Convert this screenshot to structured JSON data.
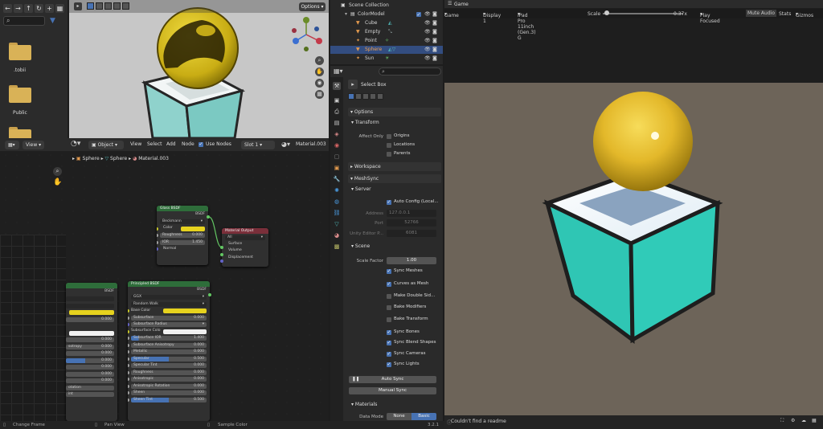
{
  "file_browser": {
    "folders": [
      {
        "label": ".tobii"
      },
      {
        "label": "Public"
      },
      {
        "label": ""
      }
    ]
  },
  "viewport3d": {
    "options_label": "Options"
  },
  "node_editor": {
    "editor_type": "Object",
    "menu": [
      "View",
      "Select",
      "Add",
      "Node"
    ],
    "use_nodes_label": "Use Nodes",
    "use_nodes": true,
    "slot": "Slot 1",
    "material_name": "Material.003",
    "breadcrumb": [
      "Sphere",
      "Sphere",
      "Material.003"
    ],
    "view_label": "View",
    "glass_node": {
      "title": "Glass BSDF",
      "output": "BSDF",
      "distribution": "Beckmann",
      "color_label": "Color",
      "roughness_label": "Roughness",
      "roughness": "0.000",
      "ior_label": "IOR",
      "ior": "1.450",
      "normal_label": "Normal"
    },
    "output_node": {
      "title": "Material Output",
      "target": "All",
      "inputs": [
        "Surface",
        "Volume",
        "Displacement"
      ]
    },
    "principled_node": {
      "title": "Principled BSDF",
      "output": "BSDF",
      "distribution": "GGX",
      "subsurface_method": "Random Walk",
      "rows": [
        {
          "label": "Base Color",
          "value": ""
        },
        {
          "label": "Subsurface",
          "value": "0.000"
        },
        {
          "label": "Subsurface Radius",
          "value": ""
        },
        {
          "label": "Subsurface Colo",
          "value": ""
        },
        {
          "label": "Subsurface IOR",
          "value": "1.400"
        },
        {
          "label": "Subsurface Anisotropy",
          "value": "0.000"
        },
        {
          "label": "Metallic",
          "value": "0.000"
        },
        {
          "label": "Specular",
          "value": "0.500"
        },
        {
          "label": "Specular Tint",
          "value": "0.000"
        },
        {
          "label": "Roughness",
          "value": "0.000"
        },
        {
          "label": "Anisotropic",
          "value": "0.000"
        },
        {
          "label": "Anisotropic Rotation",
          "value": "0.000"
        },
        {
          "label": "Sheen",
          "value": "0.000"
        },
        {
          "label": "Sheen Tint",
          "value": "0.500"
        }
      ]
    },
    "partial_node": {
      "output": "BSDF",
      "values": [
        "0.000",
        "0.000",
        "0.000",
        "0.000",
        "0.000",
        "0.000",
        "0.000",
        "0.000"
      ],
      "labels": [
        "sotropy",
        "otation",
        "int"
      ]
    }
  },
  "statusbar": {
    "items": [
      "Change Frame",
      "Pan View",
      "Sample Color"
    ],
    "version": "3.2.1"
  },
  "outliner": {
    "title": "Scene Collection",
    "items": [
      {
        "name": "ColorModel",
        "icon": "collection-icon",
        "selected": false
      },
      {
        "name": "Cube",
        "icon": "mesh-icon",
        "selected": false
      },
      {
        "name": "Empty",
        "icon": "empty-icon",
        "selected": false
      },
      {
        "name": "Point",
        "icon": "light-icon",
        "selected": false
      },
      {
        "name": "Sphere",
        "icon": "mesh-icon",
        "selected": true
      },
      {
        "name": "Sun",
        "icon": "light-icon",
        "selected": false
      }
    ]
  },
  "properties": {
    "tool_name": "Select Box",
    "options_section": "Options",
    "transform_section": "Transform",
    "affect_only_label": "Affect Only",
    "affect_only": [
      "Origins",
      "Locations",
      "Parents"
    ],
    "workspace_section": "Workspace",
    "meshsync_section": "MeshSync",
    "server_section": "Server",
    "auto_config_label": "Auto Config (Local...",
    "address_label": "Address",
    "address": "127.0.0.1",
    "port_label": "Port",
    "port": "52766",
    "unity_editor_label": "Unity Editor P...",
    "unity_editor_value": "6081",
    "scene_section": "Scene",
    "scale_factor_label": "Scale Factor",
    "scale_factor": "1.00",
    "checks": [
      {
        "label": "Sync Meshes",
        "on": true
      },
      {
        "label": "Curves as Mesh",
        "on": true
      },
      {
        "label": "Make Double Sid...",
        "on": false
      },
      {
        "label": "Bake Modifiers",
        "on": false
      },
      {
        "label": "Bake Transform",
        "on": false
      },
      {
        "label": "Sync Bones",
        "on": true
      },
      {
        "label": "Sync Blend Shapes",
        "on": true
      },
      {
        "label": "Sync Cameras",
        "on": true
      },
      {
        "label": "Sync Lights",
        "on": true
      }
    ],
    "auto_sync_label": "Auto Sync",
    "manual_sync_label": "Manual Sync",
    "materials_section": "Materials",
    "data_mode_label": "Data Mode",
    "data_mode_options": [
      "None",
      "Basic"
    ],
    "data_mode_selected": "Basic"
  },
  "game_view": {
    "tab": "Game",
    "mode": "Game",
    "display": "Display 1",
    "device": "iPad Pro 11inch (Gen.3) G",
    "scale_label": "Scale",
    "scale_value": "0.37x",
    "play_focused": "Play Focused",
    "mute_audio": "Mute Audio",
    "stats": "Stats",
    "gizmos": "Gizmos",
    "status_message": "Couldn't find a readme"
  }
}
